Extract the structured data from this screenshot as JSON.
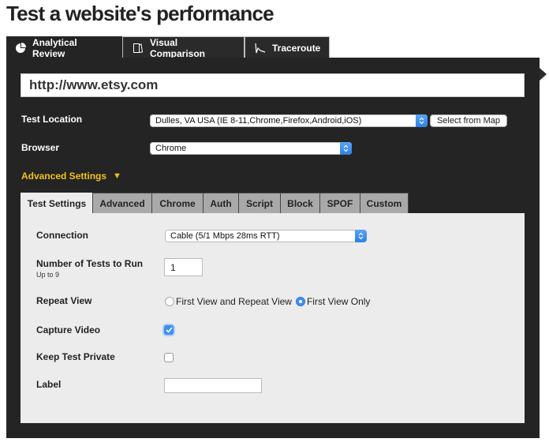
{
  "page": {
    "title": "Test a website's performance"
  },
  "top_tabs": [
    {
      "label": "Analytical Review",
      "icon": "pie-chart-icon",
      "active": true
    },
    {
      "label": "Visual Comparison",
      "icon": "documents-icon",
      "active": false
    },
    {
      "label": "Traceroute",
      "icon": "traceroute-icon",
      "active": false
    }
  ],
  "url_input": {
    "value": "http://www.etsy.com"
  },
  "test_location": {
    "label": "Test Location",
    "selected": "Dulles, VA USA (IE 8-11,Chrome,Firefox,Android,iOS)",
    "map_button": "Select from Map"
  },
  "browser": {
    "label": "Browser",
    "selected": "Chrome"
  },
  "advanced": {
    "label": "Advanced Settings",
    "toggle_icon": "triangle-down-icon"
  },
  "inner_tabs": [
    {
      "label": "Test Settings",
      "active": true
    },
    {
      "label": "Advanced",
      "active": false
    },
    {
      "label": "Chrome",
      "active": false
    },
    {
      "label": "Auth",
      "active": false
    },
    {
      "label": "Script",
      "active": false
    },
    {
      "label": "Block",
      "active": false
    },
    {
      "label": "SPOF",
      "active": false
    },
    {
      "label": "Custom",
      "active": false
    }
  ],
  "settings": {
    "connection": {
      "label": "Connection",
      "selected": "Cable (5/1 Mbps 28ms RTT)"
    },
    "num_tests": {
      "label": "Number of Tests to Run",
      "hint": "Up to 9",
      "value": "1"
    },
    "repeat_view": {
      "label": "Repeat View",
      "options": [
        {
          "label": "First View and Repeat View",
          "checked": false
        },
        {
          "label": "First View Only",
          "checked": true
        }
      ]
    },
    "capture_video": {
      "label": "Capture Video",
      "checked": true
    },
    "keep_private": {
      "label": "Keep Test Private",
      "checked": false
    },
    "test_label": {
      "label": "Label",
      "value": ""
    }
  },
  "colors": {
    "frame": "#242424",
    "accent": "#f3c21a",
    "panel": "#ececec",
    "control_blue": "#3d8ef0"
  }
}
